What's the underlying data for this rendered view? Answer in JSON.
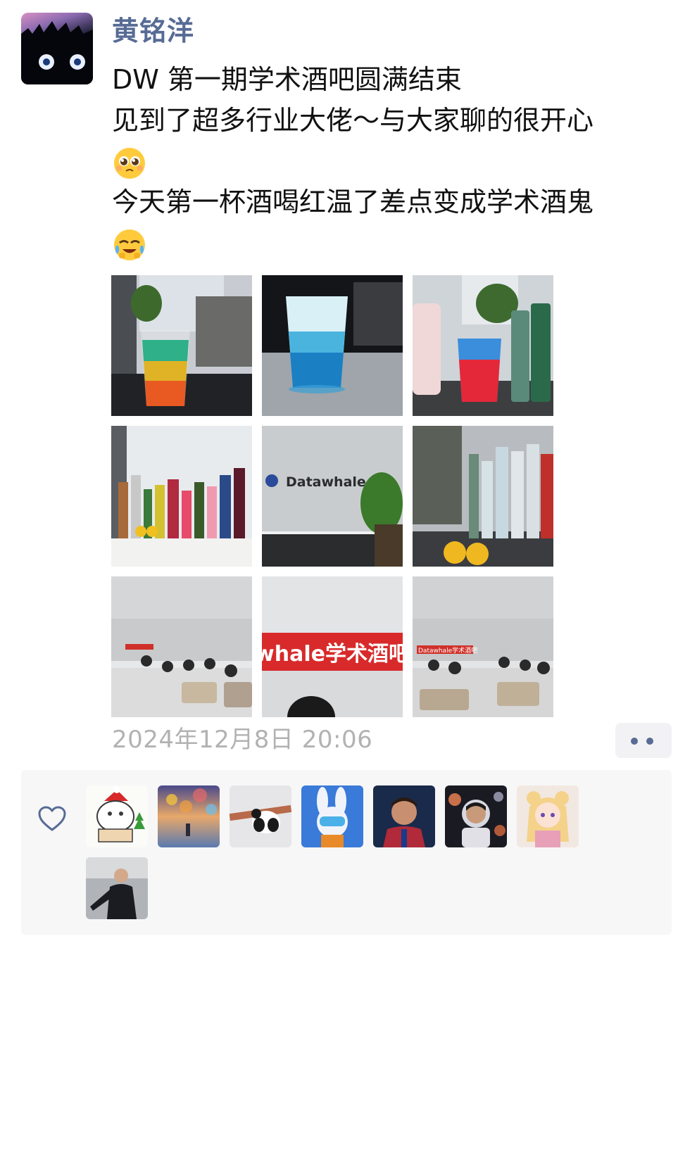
{
  "post": {
    "author": "黄铭洋",
    "lines": [
      "DW 第一期学术酒吧圆满结束",
      "见到了超多行业大佬～与大家聊的很开心",
      "今天第一杯酒喝红温了差点变成学术酒鬼"
    ],
    "emojis": [
      "pleading-face",
      "face-holding-back-tears"
    ],
    "photo_texts": [
      "Datawhale",
      "whale学术酒吧",
      "Datawhale学术酒吧"
    ],
    "timestamp": "2024年12月8日 20:06"
  },
  "actions": {
    "more_icon": "more-dots-icon",
    "like_icon": "heart-outline-icon"
  },
  "colors": {
    "author_link": "#576b95",
    "timestamp": "#b2b2b2",
    "likes_bg": "#f7f7f7"
  }
}
